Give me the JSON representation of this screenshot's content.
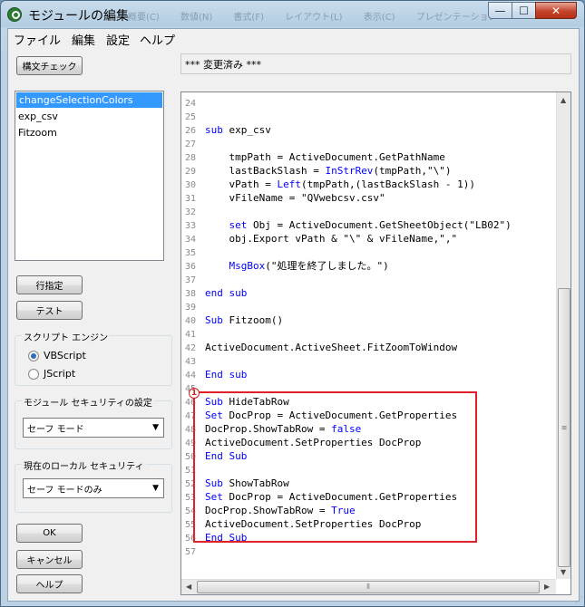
{
  "window": {
    "title": "モジュールの編集",
    "background_tabs": [
      "概要(C)",
      "数値(N)",
      "書式(F)",
      "レイアウト(L)",
      "表示(C)",
      "プレゼンテーション"
    ],
    "controls": {
      "minimize": "—",
      "maximize": "☐",
      "close": "✕"
    }
  },
  "menu": [
    "ファイル",
    "編集",
    "設定",
    "ヘルプ"
  ],
  "buttons": {
    "syntax_check": "構文チェック",
    "goto_line": "行指定",
    "test": "テスト",
    "ok": "OK",
    "cancel": "キャンセル",
    "help": "ヘルプ"
  },
  "status_text": "*** 変更済み ***",
  "modules": [
    "changeSelectionColors",
    "exp_csv",
    "Fitzoom"
  ],
  "selected_module_index": 0,
  "script_engine": {
    "label": "スクリプト エンジン",
    "options": [
      "VBScript",
      "JScript"
    ],
    "selected": "VBScript"
  },
  "module_security": {
    "label": "モジュール セキュリティの設定",
    "value": "セーフ モード"
  },
  "local_security": {
    "label": "現在のローカル セキュリティ",
    "value": "セーフ モードのみ"
  },
  "annotation_marker": "1",
  "code_lines": [
    {
      "n": "24",
      "t": []
    },
    {
      "n": "25",
      "t": []
    },
    {
      "n": "26",
      "t": [
        {
          "k": 1,
          "s": "sub"
        },
        {
          "k": 0,
          "s": " exp_csv"
        }
      ]
    },
    {
      "n": "27",
      "t": []
    },
    {
      "n": "28",
      "t": [
        {
          "k": 0,
          "s": "    tmpPath = ActiveDocument.GetPathName"
        }
      ]
    },
    {
      "n": "29",
      "t": [
        {
          "k": 0,
          "s": "    lastBackSlash = "
        },
        {
          "k": 1,
          "s": "InStrRev"
        },
        {
          "k": 0,
          "s": "(tmpPath,\"\\\")"
        }
      ]
    },
    {
      "n": "30",
      "t": [
        {
          "k": 0,
          "s": "    vPath = "
        },
        {
          "k": 1,
          "s": "Left"
        },
        {
          "k": 0,
          "s": "(tmpPath,(lastBackSlash - 1))"
        }
      ]
    },
    {
      "n": "31",
      "t": [
        {
          "k": 0,
          "s": "    vFileName = \"QVwebcsv.csv\""
        }
      ]
    },
    {
      "n": "32",
      "t": []
    },
    {
      "n": "33",
      "t": [
        {
          "k": 0,
          "s": "    "
        },
        {
          "k": 1,
          "s": "set"
        },
        {
          "k": 0,
          "s": " Obj = ActiveDocument.GetSheetObject(\"LB02\")"
        }
      ]
    },
    {
      "n": "34",
      "t": [
        {
          "k": 0,
          "s": "    obj.Export vPath & \"\\\" & vFileName,\",\""
        }
      ]
    },
    {
      "n": "35",
      "t": []
    },
    {
      "n": "36",
      "t": [
        {
          "k": 0,
          "s": "    "
        },
        {
          "k": 1,
          "s": "MsgBox"
        },
        {
          "k": 0,
          "s": "(\"処理を終了しました。\")"
        }
      ]
    },
    {
      "n": "37",
      "t": []
    },
    {
      "n": "38",
      "t": [
        {
          "k": 1,
          "s": "end sub"
        }
      ]
    },
    {
      "n": "39",
      "t": []
    },
    {
      "n": "40",
      "t": [
        {
          "k": 1,
          "s": "Sub"
        },
        {
          "k": 0,
          "s": " Fitzoom()"
        }
      ]
    },
    {
      "n": "41",
      "t": []
    },
    {
      "n": "42",
      "t": [
        {
          "k": 0,
          "s": "ActiveDocument.ActiveSheet.FitZoomToWindow"
        }
      ]
    },
    {
      "n": "43",
      "t": []
    },
    {
      "n": "44",
      "t": [
        {
          "k": 1,
          "s": "End sub"
        }
      ]
    },
    {
      "n": "45",
      "t": []
    },
    {
      "n": "46",
      "t": [
        {
          "k": 1,
          "s": "Sub"
        },
        {
          "k": 0,
          "s": " HideTabRow"
        }
      ]
    },
    {
      "n": "47",
      "t": [
        {
          "k": 1,
          "s": "Set"
        },
        {
          "k": 0,
          "s": " DocProp = ActiveDocument.GetProperties"
        }
      ]
    },
    {
      "n": "48",
      "t": [
        {
          "k": 0,
          "s": "DocProp.ShowTabRow = "
        },
        {
          "k": 1,
          "s": "false"
        }
      ]
    },
    {
      "n": "49",
      "t": [
        {
          "k": 0,
          "s": "ActiveDocument.SetProperties DocProp"
        }
      ]
    },
    {
      "n": "50",
      "t": [
        {
          "k": 1,
          "s": "End Sub"
        }
      ]
    },
    {
      "n": "51",
      "t": []
    },
    {
      "n": "52",
      "t": [
        {
          "k": 1,
          "s": "Sub"
        },
        {
          "k": 0,
          "s": " ShowTabRow"
        }
      ]
    },
    {
      "n": "53",
      "t": [
        {
          "k": 1,
          "s": "Set"
        },
        {
          "k": 0,
          "s": " DocProp = ActiveDocument.GetProperties"
        }
      ]
    },
    {
      "n": "54",
      "t": [
        {
          "k": 0,
          "s": "DocProp.ShowTabRow = "
        },
        {
          "k": 1,
          "s": "True"
        }
      ]
    },
    {
      "n": "55",
      "t": [
        {
          "k": 0,
          "s": "ActiveDocument.SetProperties DocProp"
        }
      ]
    },
    {
      "n": "56",
      "t": [
        {
          "k": 1,
          "s": "End Sub"
        }
      ]
    },
    {
      "n": "57",
      "t": []
    }
  ],
  "colors": {
    "keyword": "#0000ff",
    "selection": "#3399ff",
    "annotation": "#e0202a"
  }
}
